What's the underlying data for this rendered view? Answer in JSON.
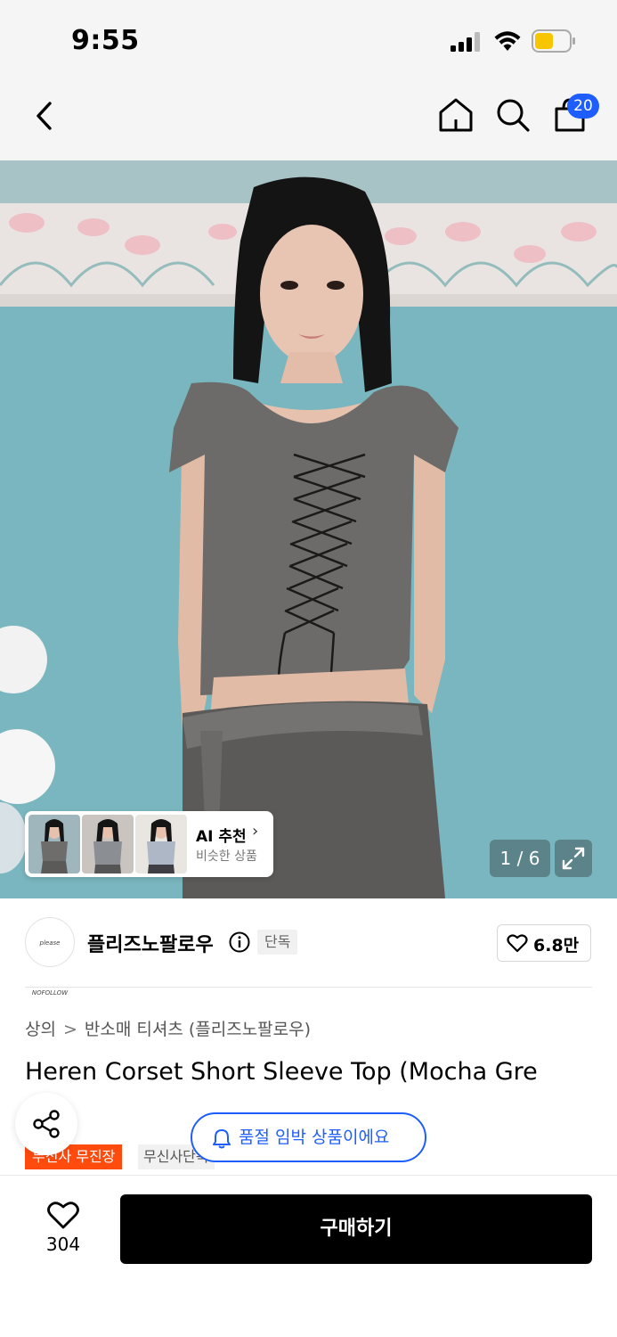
{
  "status_bar": {
    "time": "9:55"
  },
  "nav": {
    "cart_count": "20"
  },
  "gallery": {
    "counter": "1 / 6",
    "ai": {
      "title": "AI 추천",
      "subtitle": "비슷한 상품"
    }
  },
  "brand": {
    "logo_text": "please NOFOLLOW",
    "name": "플리즈노팔로우",
    "badge": "단독",
    "likes": "6.8만"
  },
  "breadcrumb": {
    "level1": "상의",
    "separator": ">",
    "level2": "반소매 티셔츠 (플리즈노팔로우)"
  },
  "product": {
    "title": "Heren Corset Short Sleeve Top (Mocha Gre",
    "tags": [
      "무신사 무진장",
      "무신사단독"
    ]
  },
  "alert": {
    "text": "품절 임박 상품이에요"
  },
  "bottom": {
    "wish_count": "304",
    "buy_label": "구매하기"
  },
  "colors": {
    "accent_blue": "#1e5eff",
    "tag_red": "#ff4b0d",
    "buy_bg": "#000000"
  },
  "icons": [
    "back-icon",
    "home-icon",
    "search-icon",
    "cart-icon",
    "expand-icon",
    "info-icon",
    "heart-icon",
    "share-icon",
    "bell-icon"
  ]
}
